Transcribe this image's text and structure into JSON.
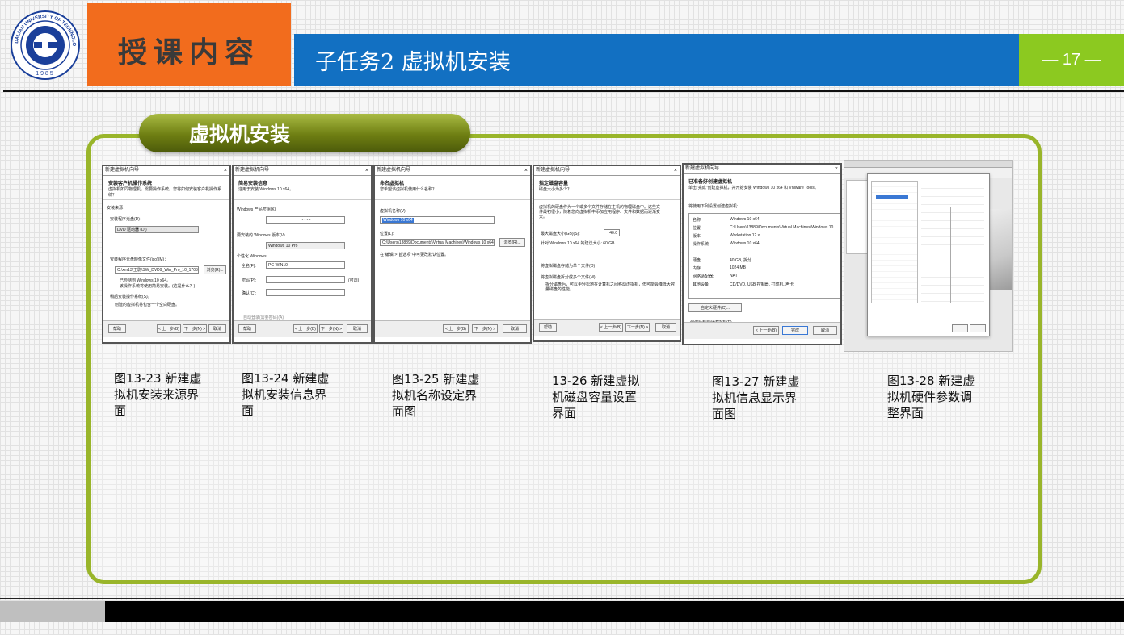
{
  "header": {
    "logo_text_top": "DALIAN UNIVERSITY OF TECHNOLOGY PRESS",
    "logo_year": "1985",
    "section_label": "授课内容",
    "topic_title": "子任务2 虚拟机安装",
    "page_number": "— 17 —"
  },
  "colors": {
    "orange": "#f26c1d",
    "blue": "#1270c2",
    "green": "#8cc920",
    "olive": "#99b52a"
  },
  "section": {
    "title": "虚拟机安装"
  },
  "screenshots": [
    {
      "window_title": "新建虚拟机向导",
      "header_title": "安装客户机操作系统",
      "header_sub": "虚拟机如同物理机，需要操作系统。您将如何安装客户机操作系统？",
      "group_label": "安装来源：",
      "opt1": "安装程序光盘(D)：",
      "drive": "DVD 驱动器 (D:)",
      "opt2": "安装程序光盘映像文件(iso)(M)：",
      "iso_path": "C:\\xm13\\王影\\SW_DVD9_Win_Pro_10_1703.1_64BIT_C",
      "browse": "浏览(R)...",
      "detected": "已检测到 Windows 10 x64。",
      "detected_sub": "该操作系统将使用简易安装。(这是什么？)",
      "opt3": "稍后安装操作系统(S)。",
      "opt3_sub": "创建的虚拟机将包含一个空白硬盘。",
      "help": "帮助",
      "back": "< 上一步(B)",
      "next": "下一步(N) >",
      "cancel": "取消"
    },
    {
      "window_title": "新建虚拟机向导",
      "header_title": "简易安装信息",
      "header_sub": "这用于安装 Windows 10 x64。",
      "key_label": "Windows 产品密钥(K)",
      "key_value": "-     -     -     -",
      "version_label": "要安装的 Windows 版本(V)",
      "version_value": "Windows 10 Pro",
      "personal_label": "个性化 Windows",
      "fullname_label": "全名(F):",
      "fullname_value": "PC-WIN10",
      "password_label": "密码(P):",
      "optional": "(可选)",
      "confirm_label": "确认(C):",
      "autologin": "自动登录(需要密码)(A)",
      "help": "帮助",
      "back": "< 上一步(B)",
      "next": "下一步(N) >",
      "cancel": "取消"
    },
    {
      "window_title": "新建虚拟机向导",
      "header_title": "命名虚拟机",
      "header_sub": "您希望该虚拟机使用什么名称？",
      "name_label": "虚拟机名称(V):",
      "name_value": "Windows 10 x64",
      "location_label": "位置(L):",
      "location_value": "C:\\Users\\13889\\Documents\\Virtual Machines\\Windows 10 x64",
      "browse": "浏览(R)...",
      "hint": "在\"编辑\">\"首选项\"中可更改默认位置。",
      "back": "< 上一步(B)",
      "next": "下一步(N) >",
      "cancel": "取消"
    },
    {
      "window_title": "新建虚拟机向导",
      "header_title": "指定磁盘容量",
      "header_sub": "磁盘大小为多少？",
      "desc": "虚拟机的硬盘作为一个或多个文件存储在主机的物理磁盘中。这些文件最初很小，随着您向虚拟机中添加应用程序、文件和数据而逐渐变大。",
      "size_label": "最大磁盘大小(GB)(S):",
      "size_value": "40.0",
      "recommend": "针对 Windows 10 x64 的建议大小: 60 GB",
      "single_file": "将虚拟磁盘存储为单个文件(O)",
      "multi_file": "将虚拟磁盘拆分成多个文件(M)",
      "multi_desc": "拆分磁盘后，可以更轻松地在计算机之间移动虚拟机，但可能会降低大容量磁盘的性能。",
      "help": "帮助",
      "back": "< 上一步(B)",
      "next": "下一步(N) >",
      "cancel": "取消"
    },
    {
      "window_title": "新建虚拟机向导",
      "header_title": "已准备好创建虚拟机",
      "header_sub": "单击\"完成\"创建虚拟机，并开始安装 Windows 10 x64 和 VMware Tools。",
      "settings_label": "将使用下列设置创建虚拟机:",
      "rows": [
        {
          "k": "名称:",
          "v": "Windows 10 x64"
        },
        {
          "k": "位置:",
          "v": "C:\\Users\\13889\\Documents\\Virtual Machines\\Windows 10 ..."
        },
        {
          "k": "版本:",
          "v": "Workstation 12.x"
        },
        {
          "k": "操作系统:",
          "v": "Windows 10 x64"
        },
        {
          "k": "硬盘:",
          "v": "40 GB, 拆分"
        },
        {
          "k": "内存:",
          "v": "1024 MB"
        },
        {
          "k": "网络适配器:",
          "v": "NAT"
        },
        {
          "k": "其他设备:",
          "v": "CD/DVD, USB 控制器, 打印机, 声卡"
        }
      ],
      "customize": "自定义硬件(C)...",
      "poweron": "创建后开启此虚拟机(P)",
      "back": "< 上一步(B)",
      "finish": "完成",
      "cancel": "取消"
    }
  ],
  "captions": [
    "图13-23 新建虚\n拟机安装来源界\n面",
    "图13-24 新建虚\n拟机安装信息界\n面",
    "图13-25 新建虚\n拟机名称设定界\n面图",
    "13-26 新建虚拟\n机磁盘容量设置\n界面",
    "图13-27 新建虚\n拟机信息显示界\n面图",
    "图13-28 新建虚\n拟机硬件参数调\n整界面"
  ]
}
